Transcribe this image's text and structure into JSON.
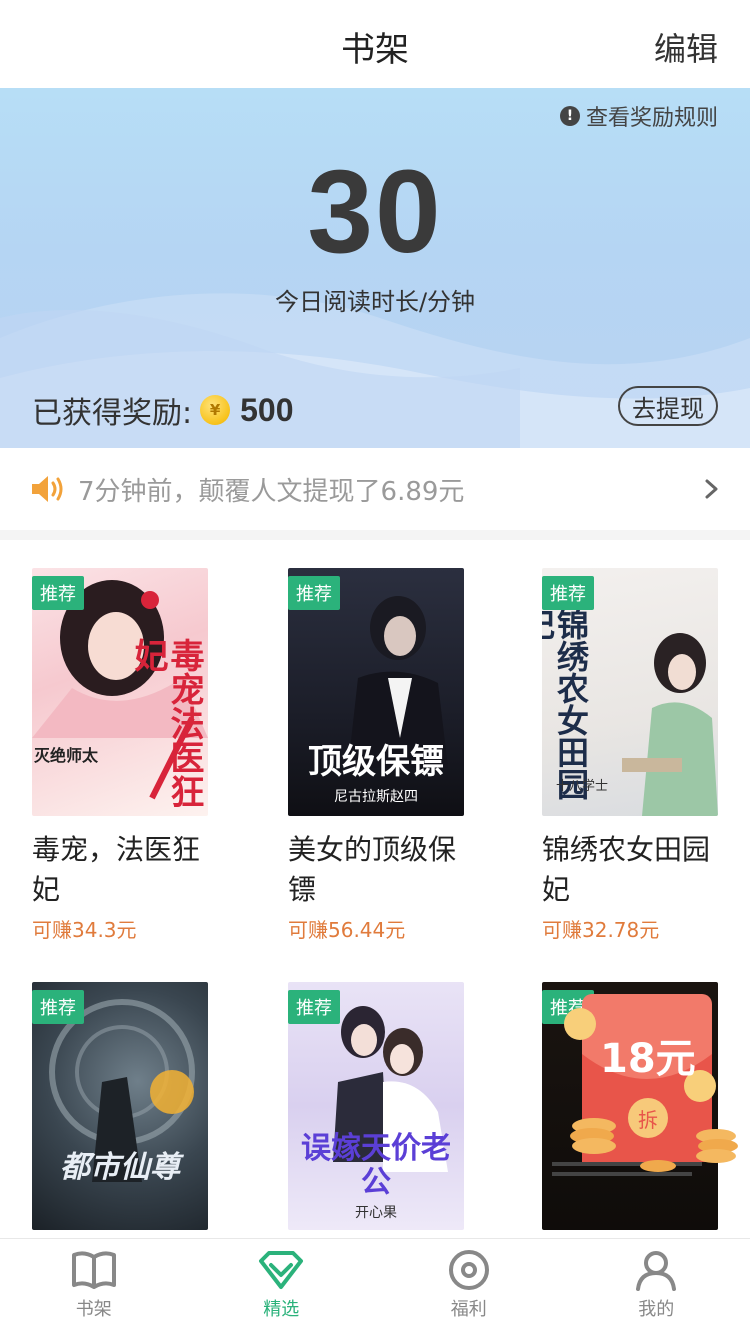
{
  "header": {
    "title": "书架",
    "edit_label": "编辑"
  },
  "reward": {
    "rules_label": "查看奖励规则",
    "minutes": "30",
    "minutes_label": "今日阅读时长/分钟",
    "earned_label": "已获得奖励:",
    "coin_symbol": "¥",
    "coins": "500",
    "withdraw_label": "去提现"
  },
  "notice": {
    "text": "7分钟前，颠覆人文提现了6.89元"
  },
  "books": [
    {
      "tag": "推荐",
      "title": "毒宠，法医狂妃",
      "earn": "可赚34.3元",
      "cover_text": "毒宠法医狂妃",
      "author_text": "灭绝师太"
    },
    {
      "tag": "推荐",
      "title": "美女的顶级保镖",
      "earn": "可赚56.44元",
      "cover_text": "顶级保镖",
      "author_text": "尼古拉斯赵四"
    },
    {
      "tag": "推荐",
      "title": "锦绣农女田园妃",
      "earn": "可赚32.78元",
      "cover_text": "锦绣农女田园妃",
      "author_text": "十八学士"
    },
    {
      "tag": "推荐",
      "title": "",
      "earn": "",
      "cover_text": "都市仙尊",
      "author_text": ""
    },
    {
      "tag": "推荐",
      "title": "",
      "earn": "",
      "cover_text": "误嫁天价老公",
      "author_text": "开心果"
    },
    {
      "tag": "推荐",
      "title": "",
      "earn": "",
      "cover_text": "",
      "author_text": ""
    }
  ],
  "promo": {
    "amount": "18元",
    "open_label": "拆"
  },
  "tabs": [
    {
      "label": "书架",
      "icon": "book-icon"
    },
    {
      "label": "精选",
      "icon": "diamond-heart-icon"
    },
    {
      "label": "福利",
      "icon": "coin-ring-icon"
    },
    {
      "label": "我的",
      "icon": "person-icon"
    }
  ],
  "colors": {
    "accent": "#2bb27b",
    "earn": "#e07b3c",
    "hero_top": "#b7def6"
  }
}
